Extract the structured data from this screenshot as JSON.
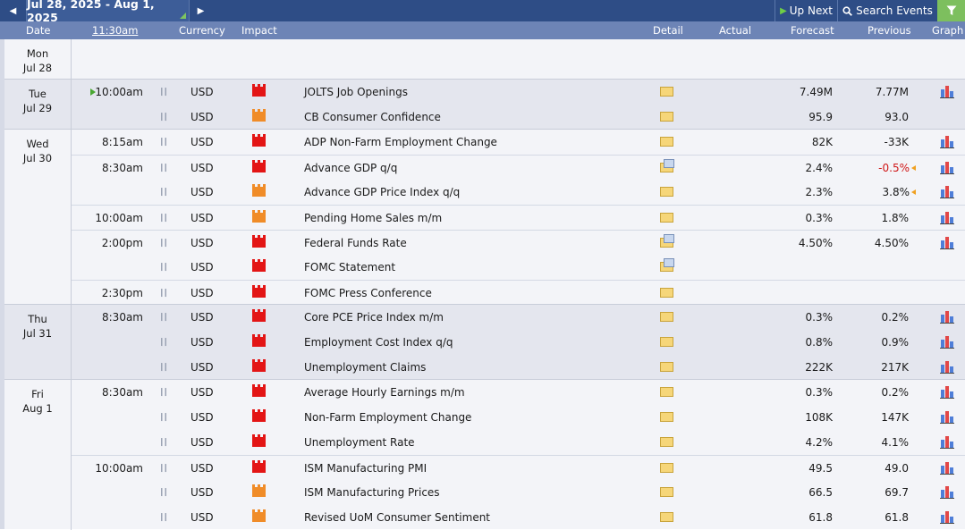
{
  "toolbar": {
    "date_range": "Jul 28, 2025 - Aug 1, 2025",
    "up_next_label": "Up Next",
    "search_label": "Search Events"
  },
  "header": {
    "date": "Date",
    "time": "11:30am",
    "currency": "Currency",
    "impact": "Impact",
    "detail": "Detail",
    "actual": "Actual",
    "forecast": "Forecast",
    "previous": "Previous",
    "graph": "Graph"
  },
  "colors": {
    "toolbar_bg": "#2e4d86",
    "header_bg": "#6d84b6",
    "shaded_day_bg": "#e4e6ee",
    "plain_day_bg": "#f3f4f8",
    "impact_high": "#e31515",
    "impact_medium": "#f08c28",
    "worse_previous": "#d01818",
    "accent_green": "#7dbf5e"
  },
  "days": [
    {
      "dow": "Mon",
      "date": "Jul 28",
      "shaded": false,
      "events": []
    },
    {
      "dow": "Tue",
      "date": "Jul 29",
      "shaded": true,
      "events": [
        {
          "time": "10:00am",
          "up_next": true,
          "currency": "USD",
          "impact": "high",
          "event": "JOLTS Job Openings",
          "detail_new": false,
          "actual": "",
          "forecast": "7.49M",
          "previous": "7.77M",
          "prev_worse": false,
          "revised": false,
          "graph": true
        },
        {
          "time": "",
          "currency": "USD",
          "impact": "medium",
          "event": "CB Consumer Confidence",
          "detail_new": false,
          "actual": "",
          "forecast": "95.9",
          "previous": "93.0",
          "prev_worse": false,
          "revised": false,
          "graph": false
        }
      ]
    },
    {
      "dow": "Wed",
      "date": "Jul 30",
      "shaded": false,
      "events": [
        {
          "time": "8:15am",
          "currency": "USD",
          "impact": "high",
          "event": "ADP Non-Farm Employment Change",
          "detail_new": false,
          "actual": "",
          "forecast": "82K",
          "previous": "-33K",
          "prev_worse": false,
          "revised": false,
          "graph": true
        },
        {
          "time": "8:30am",
          "sep": true,
          "currency": "USD",
          "impact": "high",
          "event": "Advance GDP q/q",
          "detail_new": true,
          "actual": "",
          "forecast": "2.4%",
          "previous": "-0.5%",
          "prev_worse": true,
          "revised": true,
          "graph": true
        },
        {
          "time": "",
          "currency": "USD",
          "impact": "medium",
          "event": "Advance GDP Price Index q/q",
          "detail_new": false,
          "actual": "",
          "forecast": "2.3%",
          "previous": "3.8%",
          "prev_worse": false,
          "revised": true,
          "graph": true
        },
        {
          "time": "10:00am",
          "sep": true,
          "currency": "USD",
          "impact": "medium",
          "event": "Pending Home Sales m/m",
          "detail_new": false,
          "actual": "",
          "forecast": "0.3%",
          "previous": "1.8%",
          "prev_worse": false,
          "revised": false,
          "graph": true
        },
        {
          "time": "2:00pm",
          "sep": true,
          "currency": "USD",
          "impact": "high",
          "event": "Federal Funds Rate",
          "detail_new": true,
          "actual": "",
          "forecast": "4.50%",
          "previous": "4.50%",
          "prev_worse": false,
          "revised": false,
          "graph": true
        },
        {
          "time": "",
          "currency": "USD",
          "impact": "high",
          "event": "FOMC Statement",
          "detail_new": true,
          "actual": "",
          "forecast": "",
          "previous": "",
          "prev_worse": false,
          "revised": false,
          "graph": false
        },
        {
          "time": "2:30pm",
          "sep": true,
          "currency": "USD",
          "impact": "high",
          "event": "FOMC Press Conference",
          "detail_new": false,
          "actual": "",
          "forecast": "",
          "previous": "",
          "prev_worse": false,
          "revised": false,
          "graph": false
        }
      ]
    },
    {
      "dow": "Thu",
      "date": "Jul 31",
      "shaded": true,
      "events": [
        {
          "time": "8:30am",
          "currency": "USD",
          "impact": "high",
          "event": "Core PCE Price Index m/m",
          "detail_new": false,
          "actual": "",
          "forecast": "0.3%",
          "previous": "0.2%",
          "prev_worse": false,
          "revised": false,
          "graph": true
        },
        {
          "time": "",
          "currency": "USD",
          "impact": "high",
          "event": "Employment Cost Index q/q",
          "detail_new": false,
          "actual": "",
          "forecast": "0.8%",
          "previous": "0.9%",
          "prev_worse": false,
          "revised": false,
          "graph": true
        },
        {
          "time": "",
          "currency": "USD",
          "impact": "high",
          "event": "Unemployment Claims",
          "detail_new": false,
          "actual": "",
          "forecast": "222K",
          "previous": "217K",
          "prev_worse": false,
          "revised": false,
          "graph": true
        }
      ]
    },
    {
      "dow": "Fri",
      "date": "Aug 1",
      "shaded": false,
      "events": [
        {
          "time": "8:30am",
          "currency": "USD",
          "impact": "high",
          "event": "Average Hourly Earnings m/m",
          "detail_new": false,
          "actual": "",
          "forecast": "0.3%",
          "previous": "0.2%",
          "prev_worse": false,
          "revised": false,
          "graph": true
        },
        {
          "time": "",
          "currency": "USD",
          "impact": "high",
          "event": "Non-Farm Employment Change",
          "detail_new": false,
          "actual": "",
          "forecast": "108K",
          "previous": "147K",
          "prev_worse": false,
          "revised": false,
          "graph": true
        },
        {
          "time": "",
          "currency": "USD",
          "impact": "high",
          "event": "Unemployment Rate",
          "detail_new": false,
          "actual": "",
          "forecast": "4.2%",
          "previous": "4.1%",
          "prev_worse": false,
          "revised": false,
          "graph": true
        },
        {
          "time": "10:00am",
          "sep": true,
          "currency": "USD",
          "impact": "high",
          "event": "ISM Manufacturing PMI",
          "detail_new": false,
          "actual": "",
          "forecast": "49.5",
          "previous": "49.0",
          "prev_worse": false,
          "revised": false,
          "graph": true
        },
        {
          "time": "",
          "currency": "USD",
          "impact": "medium",
          "event": "ISM Manufacturing Prices",
          "detail_new": false,
          "actual": "",
          "forecast": "66.5",
          "previous": "69.7",
          "prev_worse": false,
          "revised": false,
          "graph": true
        },
        {
          "time": "",
          "currency": "USD",
          "impact": "medium",
          "event": "Revised UoM Consumer Sentiment",
          "detail_new": false,
          "actual": "",
          "forecast": "61.8",
          "previous": "61.8",
          "prev_worse": false,
          "revised": false,
          "graph": true
        }
      ]
    }
  ]
}
